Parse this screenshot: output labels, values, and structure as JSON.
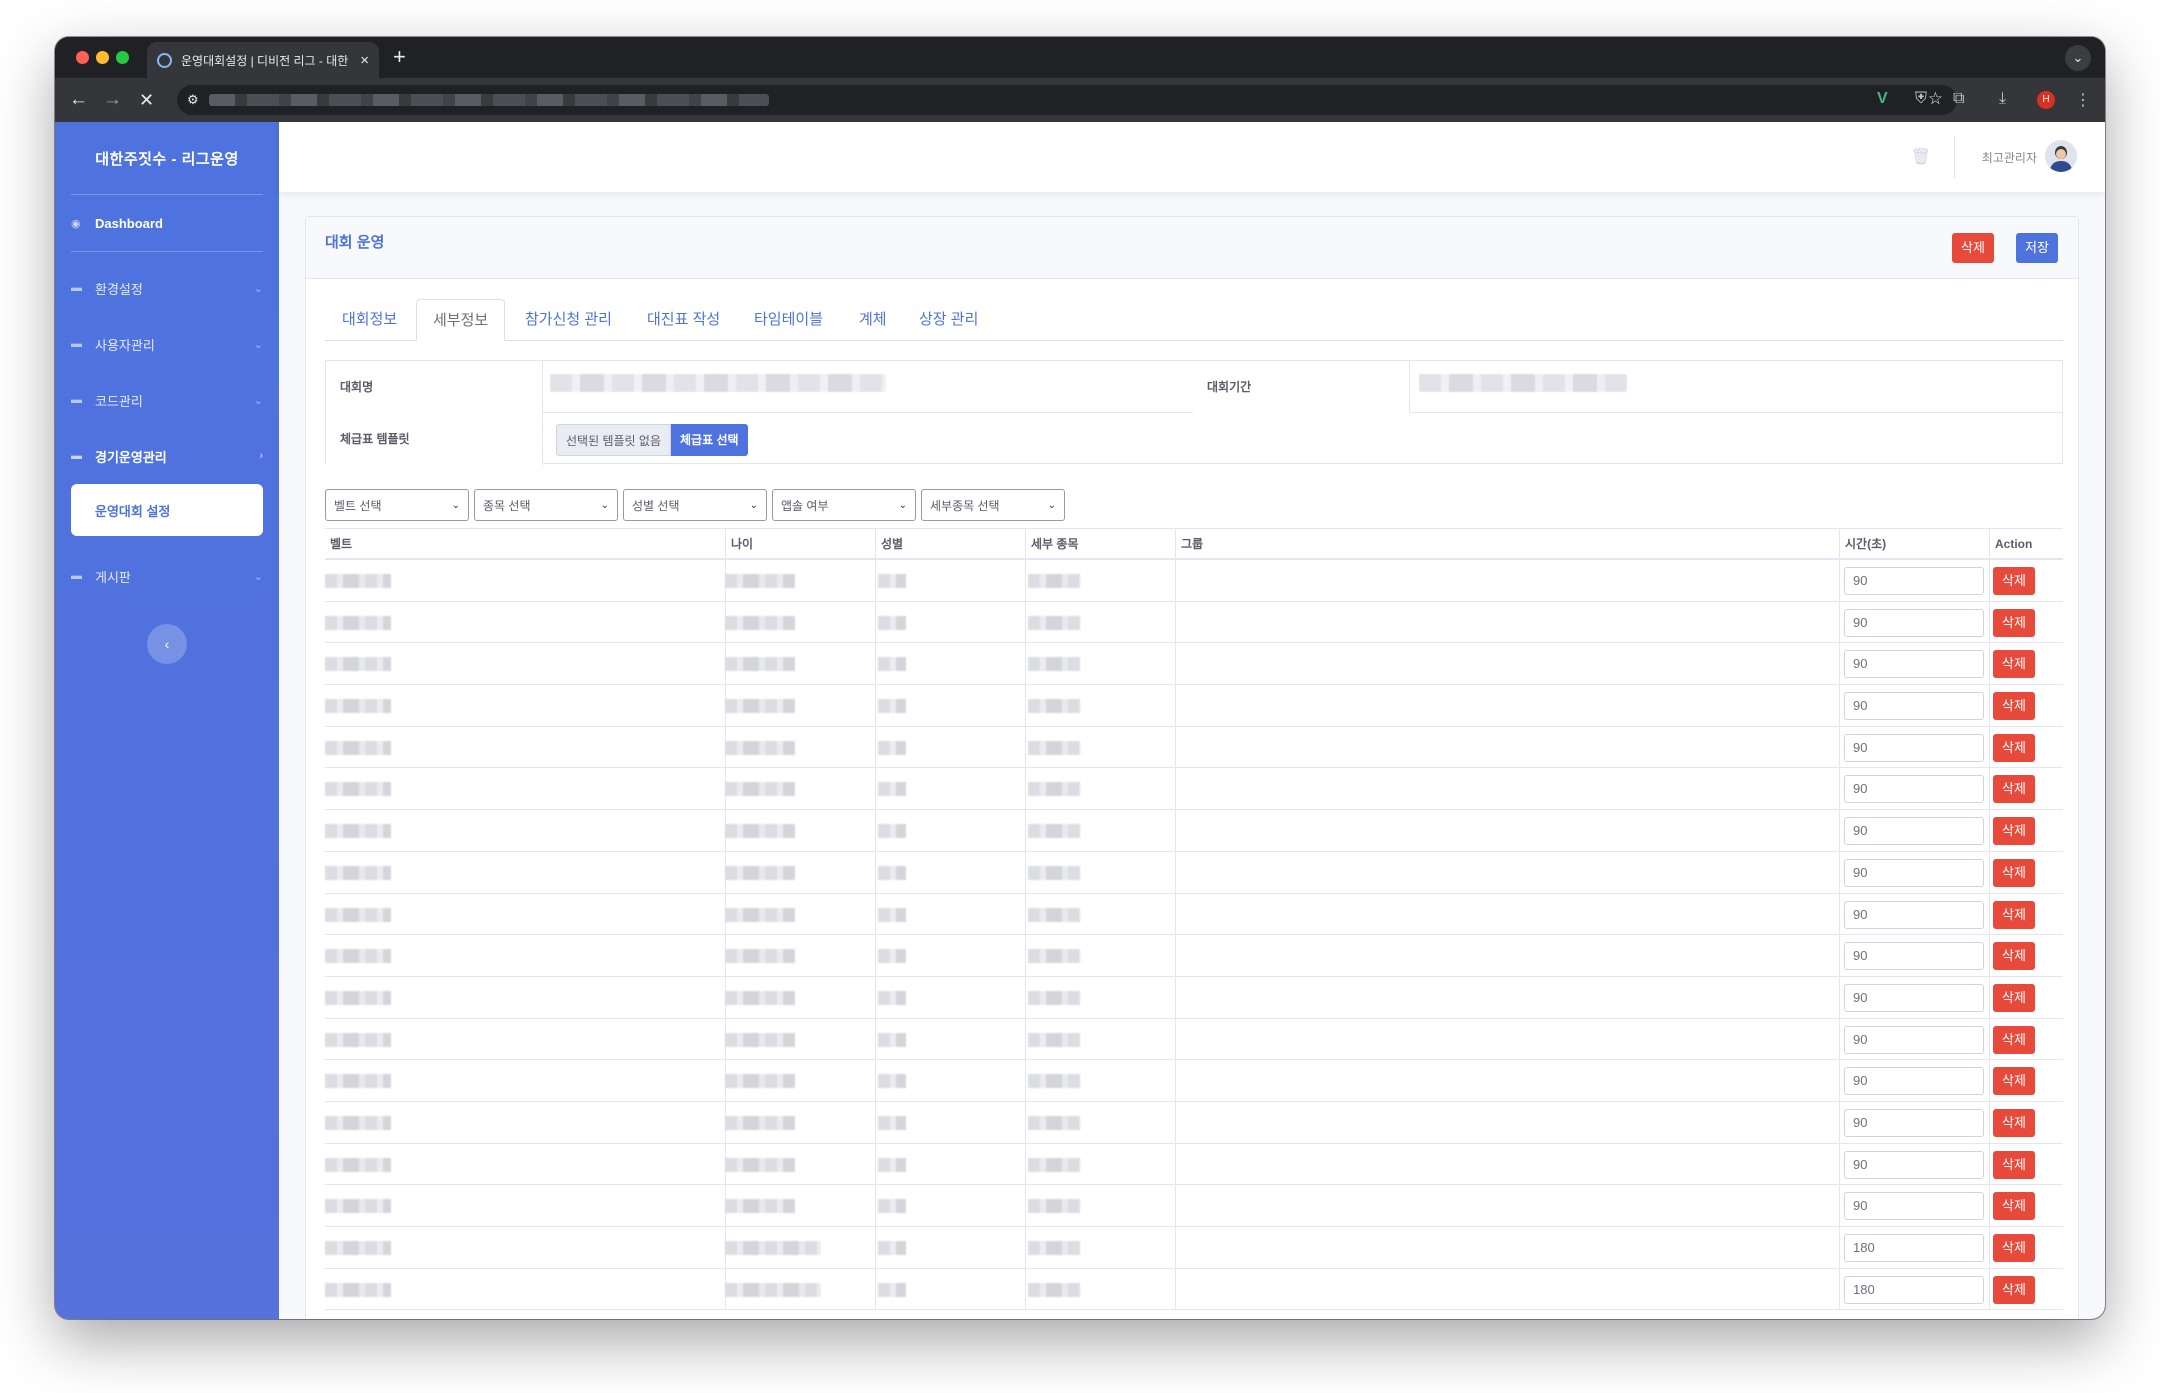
{
  "browser": {
    "tab_title": "운영대회설정 | 디비전 리그 - 대한",
    "new_tab_symbol": "+",
    "close_symbol": "×"
  },
  "sidebar": {
    "brand": "대한주짓수 - 리그운영",
    "dashboard": "Dashboard",
    "items": [
      {
        "label": "환경설정"
      },
      {
        "label": "사용자관리"
      },
      {
        "label": "코드관리"
      },
      {
        "label": "경기운영관리"
      }
    ],
    "sub_item": "운영대회 설정",
    "board": "게시판"
  },
  "topbar": {
    "user_name": "최고관리자"
  },
  "card": {
    "title": "대회 운영",
    "delete_label": "삭제",
    "save_label": "저장"
  },
  "tabs": [
    "대회정보",
    "세부정보",
    "참가신청 관리",
    "대진표 작성",
    "타임테이블",
    "계체",
    "상장 관리"
  ],
  "active_tab": "세부정보",
  "info": {
    "name_label": "대회명",
    "period_label": "대회기간",
    "template_label": "체급표 템플릿",
    "template_none": "선택된 템플릿 없음",
    "template_select": "체급표 선택"
  },
  "filters": [
    "벨트 선택",
    "종목 선택",
    "성별 선택",
    "앱솔 여부",
    "세부종목 선택"
  ],
  "grid": {
    "headers": {
      "belt": "벨트",
      "age": "나이",
      "gender": "성별",
      "detail": "세부 종목",
      "group": "그룹",
      "time": "시간(초)",
      "action": "Action"
    },
    "delete_label": "삭제",
    "times": [
      "90",
      "90",
      "90",
      "90",
      "90",
      "90",
      "90",
      "90",
      "90",
      "90",
      "90",
      "90",
      "90",
      "90",
      "90",
      "90",
      "180",
      "180"
    ]
  },
  "colors": {
    "primary": "#4e73df",
    "danger": "#e74a3b",
    "sidebar": "#4e73df"
  }
}
